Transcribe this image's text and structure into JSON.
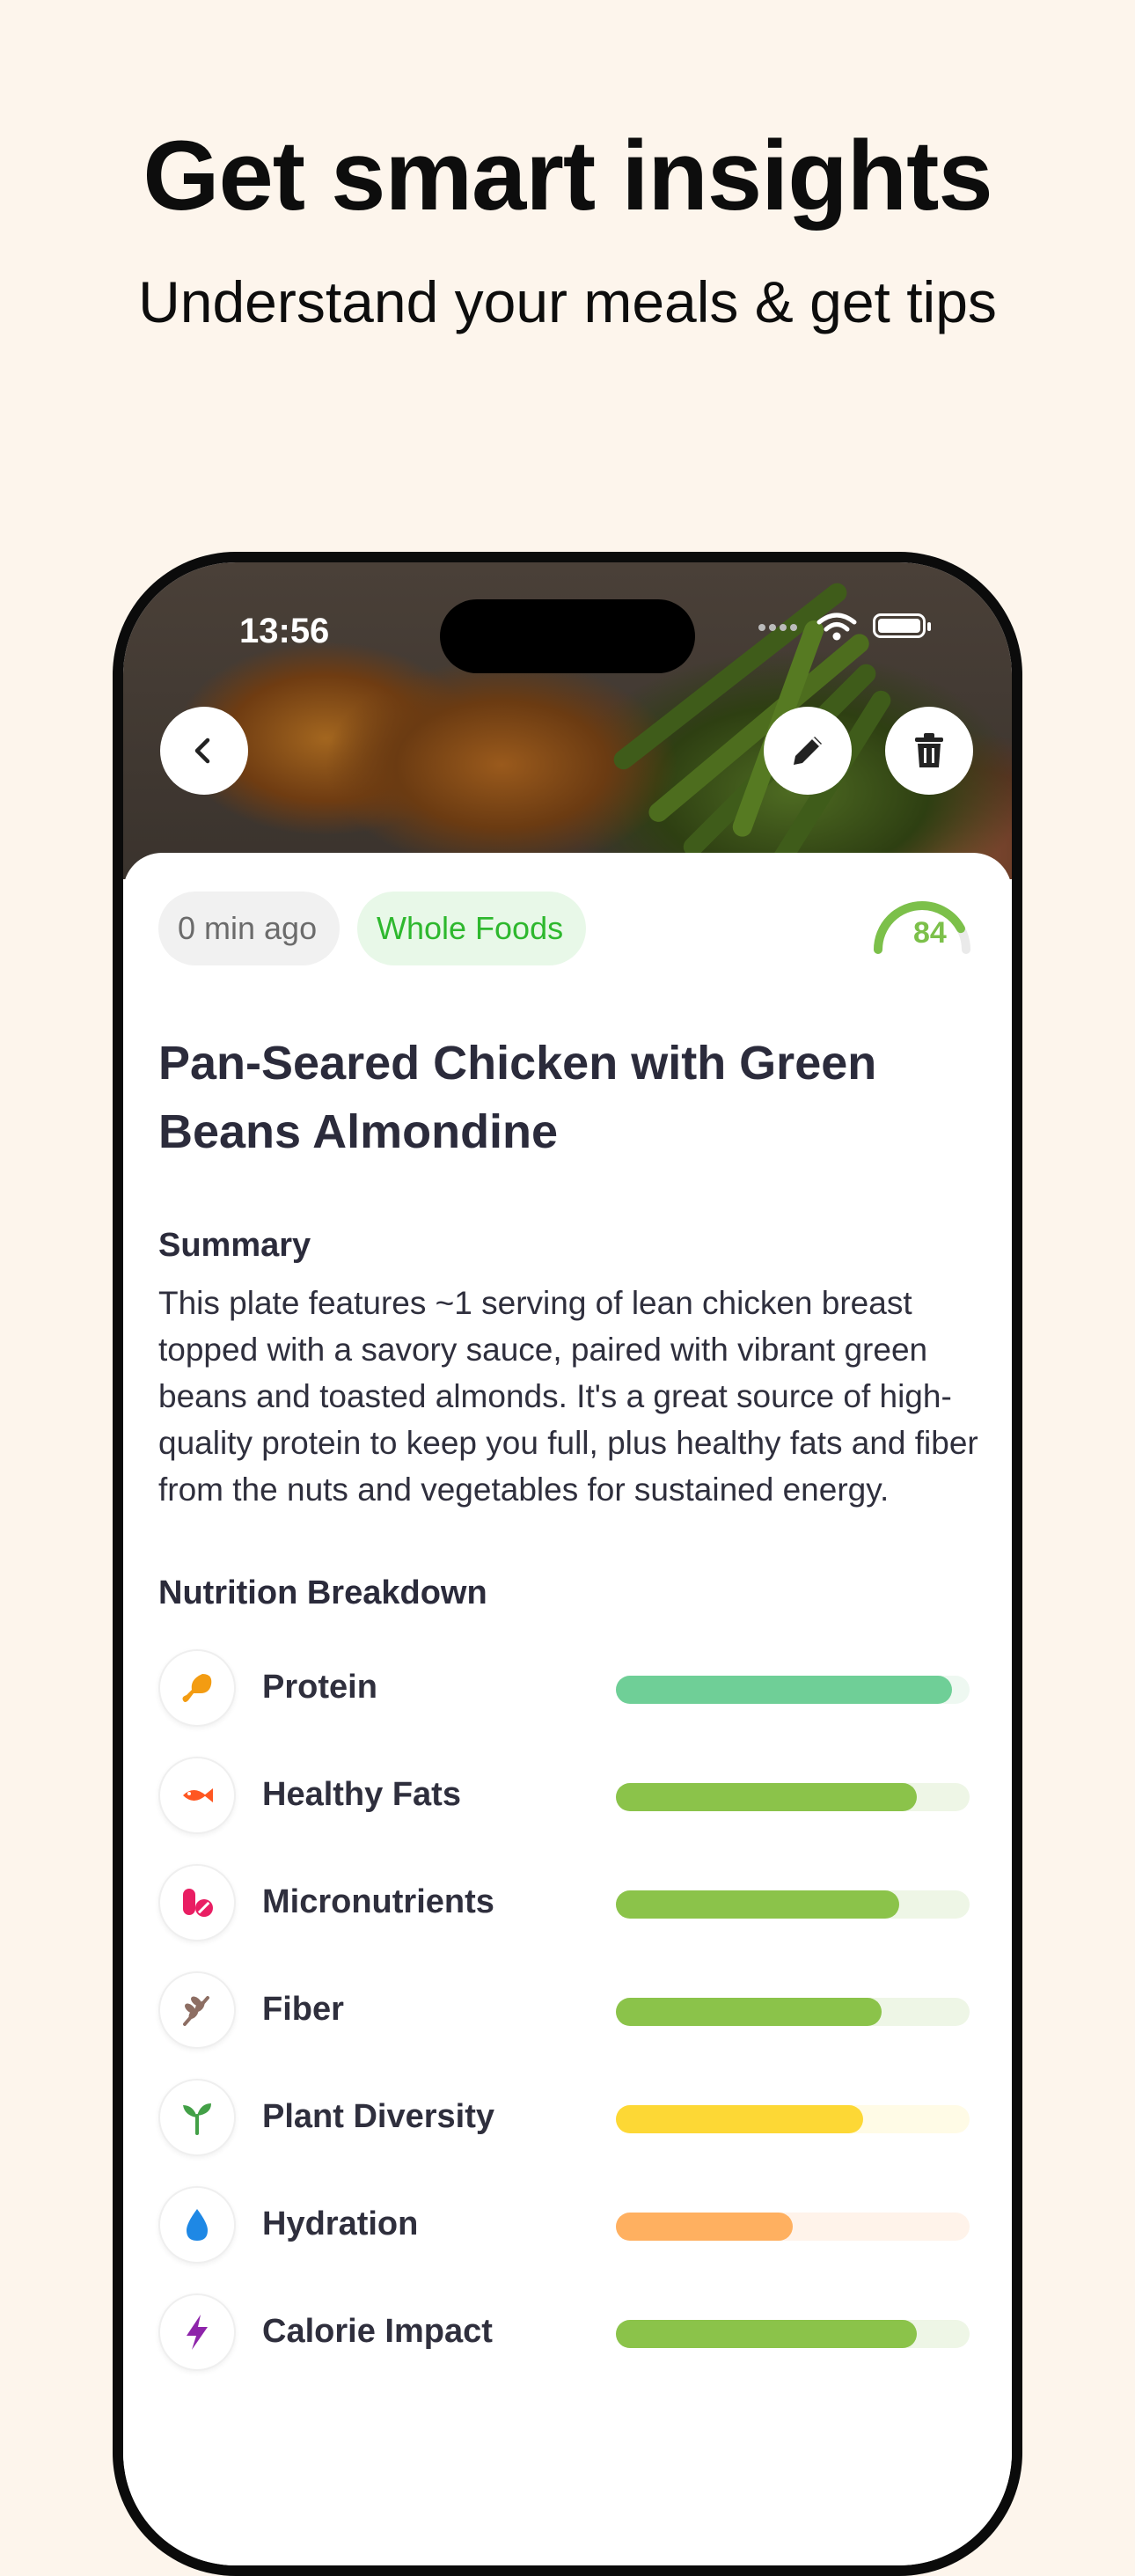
{
  "headline": "Get smart insights",
  "subheadline": "Understand your meals & get tips",
  "status_bar": {
    "time": "13:56"
  },
  "meal": {
    "time_ago": "0 min ago",
    "store": "Whole Foods",
    "score": "84",
    "score_value": 84,
    "title": "Pan-Seared Chicken with Green Beans Almondine",
    "summary_label": "Summary",
    "summary": "This plate features ~1 serving of lean chicken breast topped with a savory sauce, paired with vibrant green beans and toasted almonds. It's a great source of high-quality protein to keep you full, plus healthy fats and fiber from the nuts and vegetables for sustained energy."
  },
  "nutrition": {
    "label": "Nutrition Breakdown",
    "items": [
      {
        "label": "Protein",
        "icon": "drumstick-icon",
        "level": 0.95,
        "bar_color": "#6fcf97",
        "track_color": "#eef8f1",
        "icon_color": "#f39c12"
      },
      {
        "label": "Healthy Fats",
        "icon": "fish-icon",
        "level": 0.85,
        "bar_color": "#8bc34a",
        "track_color": "#eef6e6",
        "icon_color": "#ff5722"
      },
      {
        "label": "Micronutrients",
        "icon": "pill-icon",
        "level": 0.8,
        "bar_color": "#8bc34a",
        "track_color": "#eef6e6",
        "icon_color": "#e91e63"
      },
      {
        "label": "Fiber",
        "icon": "wheat-icon",
        "level": 0.75,
        "bar_color": "#8bc34a",
        "track_color": "#eef6e6",
        "icon_color": "#8d6e63"
      },
      {
        "label": "Plant Diversity",
        "icon": "sprout-icon",
        "level": 0.7,
        "bar_color": "#fdd835",
        "track_color": "#fffbe6",
        "icon_color": "#43a047"
      },
      {
        "label": "Hydration",
        "icon": "droplet-icon",
        "level": 0.5,
        "bar_color": "#ffb060",
        "track_color": "#fff3ea",
        "icon_color": "#1e88e5"
      },
      {
        "label": "Calorie Impact",
        "icon": "lightning-icon",
        "level": 0.85,
        "bar_color": "#8bc34a",
        "track_color": "#eef6e6",
        "icon_color": "#8e24aa"
      }
    ]
  }
}
